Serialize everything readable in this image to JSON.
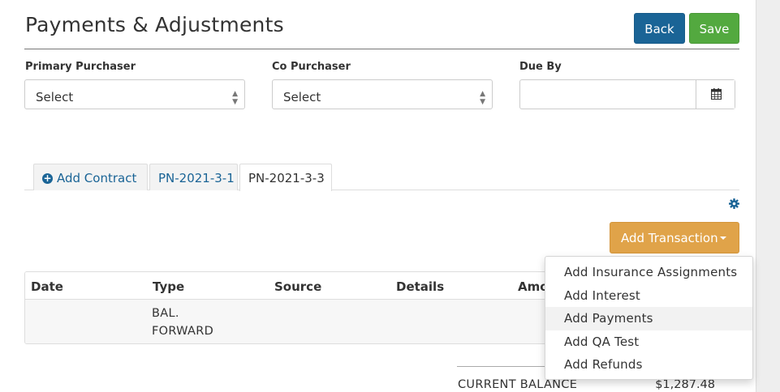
{
  "page": {
    "title": "Payments & Adjustments"
  },
  "header_buttons": {
    "back_label": "Back",
    "save_label": "Save"
  },
  "form": {
    "primary_purchaser": {
      "label": "Primary Purchaser",
      "value": "Select"
    },
    "co_purchaser": {
      "label": "Co Purchaser",
      "value": "Select"
    },
    "due_by": {
      "label": "Due By",
      "value": ""
    }
  },
  "tabs": [
    {
      "label": "Add Contract",
      "icon": "plus-circle-icon"
    },
    {
      "label": "PN-2021-3-1"
    },
    {
      "label": "PN-2021-3-3",
      "active": true
    }
  ],
  "add_transaction": {
    "label": "Add Transaction",
    "menu": [
      {
        "label": "Add Insurance Assignments"
      },
      {
        "label": "Add Interest"
      },
      {
        "label": "Add Payments",
        "highlighted": true
      },
      {
        "label": "Add QA Test"
      },
      {
        "label": "Add Refunds"
      }
    ]
  },
  "table": {
    "headers": [
      "Date",
      "Type",
      "Source",
      "Details",
      "Amo"
    ],
    "rows": [
      {
        "date": "",
        "type_line1": "BAL.",
        "type_line2": "FORWARD",
        "source": "",
        "details": ""
      }
    ]
  },
  "balance": {
    "label": "CURRENT BALANCE",
    "value": "$1,287.48"
  },
  "colors": {
    "primary": "#1a6496",
    "success": "#53a93f",
    "warning": "#e0a349"
  }
}
